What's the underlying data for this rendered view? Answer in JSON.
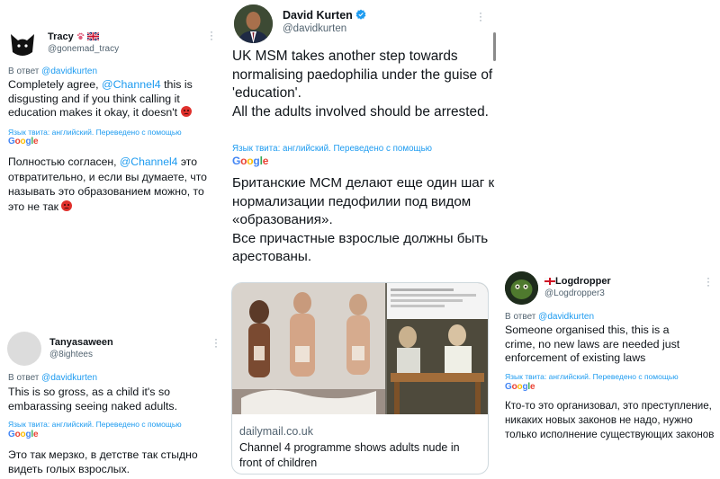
{
  "tweets": {
    "tracy": {
      "name": "Tracy",
      "handle": "@gonemad_tracy",
      "reply_prefix": "В ответ",
      "reply_to": "@davidkurten",
      "text_en_1": "Completely agree,",
      "text_en_mention": "@Channel4",
      "text_en_2": "this is disgusting and if you think calling it education makes it okay, it doesn't",
      "translated_label": "Язык твита: английский. Переведено с помощью",
      "text_ru_1": "Полностью согласен,",
      "text_ru_mention": "@Channel4",
      "text_ru_2": "это отвратительно, и если вы думаете, что называть это образованием можно, то это не так"
    },
    "tanya": {
      "name": "Tanyasaween",
      "handle": "@8ightees",
      "reply_prefix": "В ответ",
      "reply_to": "@davidkurten",
      "text_en": "This is so gross, as a child it's so embarassing seeing naked adults.",
      "translated_label": "Язык твита: английский. Переведено с помощью",
      "text_ru": "Это так мерзко, в детстве так стыдно видеть голых взрослых."
    },
    "david": {
      "name": "David Kurten",
      "handle": "@davidkurten",
      "text_en": "UK MSM takes another step towards normalising paedophilia under the guise of 'education'.\nAll the adults involved should be arrested.",
      "translated_label": "Язык твита: английский. Переведено с помощью",
      "text_ru": "Британские МСМ делают еще один шаг к нормализации педофилии под видом «образования».\nВсе причастные взрослые должны быть арестованы.",
      "link_domain": "dailymail.co.uk",
      "link_title": "Channel 4 programme shows adults nude in front of children"
    },
    "logdropper": {
      "name": "Logdropper",
      "handle": "@Logdropper3",
      "reply_prefix": "В ответ",
      "reply_to": "@davidkurten",
      "text_en": "Someone organised this, this is a crime, no new laws are needed just enforcement of existing laws",
      "translated_label": "Язык твита: английский. Переведено с помощью",
      "text_ru": "Кто-то это организовал, это преступление, никаких новых законов не надо, нужно только исполнение существующих законов"
    }
  },
  "google": {
    "g1": "G",
    "g2": "o",
    "g3": "o",
    "g4": "g",
    "g5": "l",
    "g6": "e"
  },
  "colors": {
    "link": "#1d9bf0",
    "verified": "#1d9bf0",
    "muted": "#536471"
  }
}
